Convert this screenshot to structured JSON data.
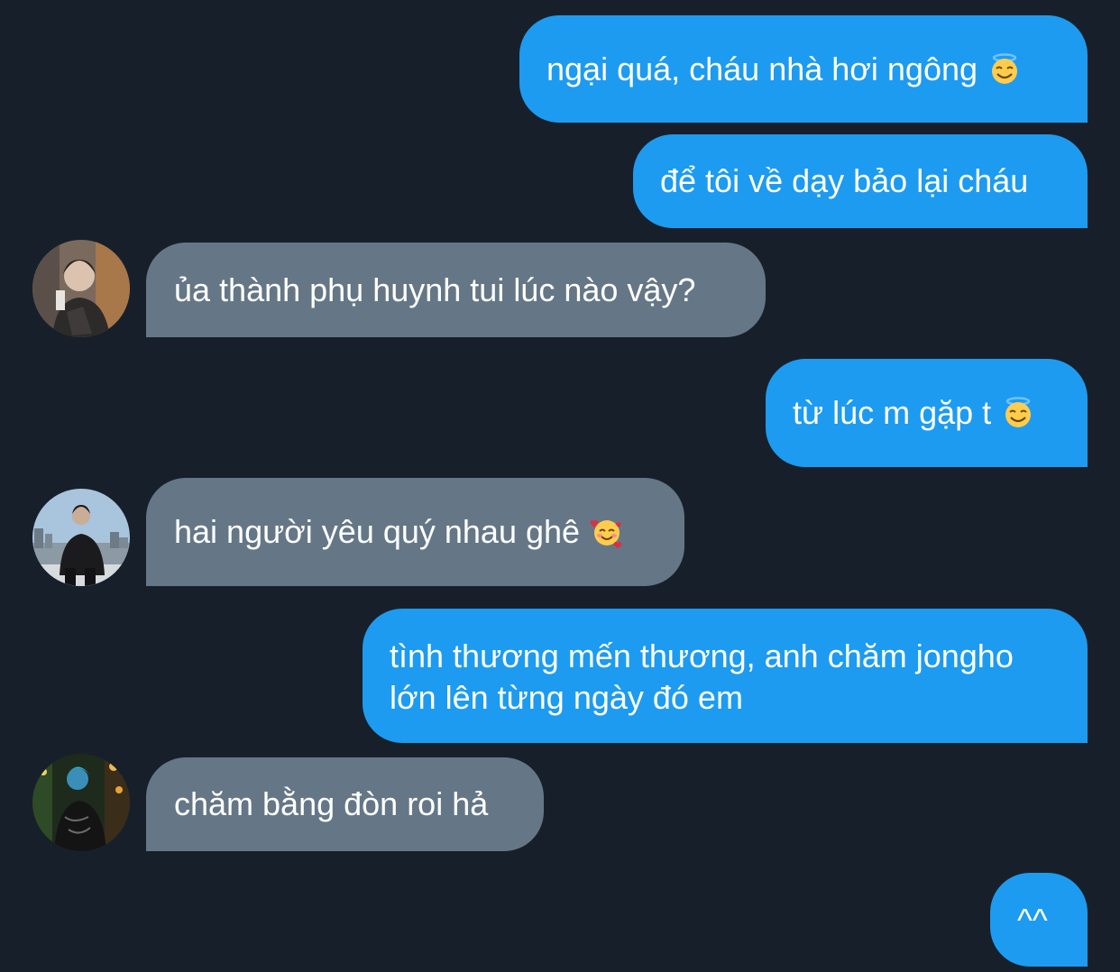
{
  "conversation": {
    "messages": [
      {
        "sender": "me",
        "text": "ngại quá, cháu nhà hơi ngông",
        "emoji": "smiling-face-with-halo"
      },
      {
        "sender": "me",
        "text": "để tôi về dạy bảo lại cháu"
      },
      {
        "sender": "other",
        "text": "ủa thành phụ huynh tui lúc nào vậy?"
      },
      {
        "sender": "me",
        "text": "từ lúc m gặp t",
        "emoji": "smiling-face-with-halo"
      },
      {
        "sender": "other",
        "text": "hai người yêu quý nhau ghê",
        "emoji": "smiling-face-with-hearts"
      },
      {
        "sender": "me",
        "lines": [
          "tình thương mến thương, anh chăm jongho",
          "lớn lên từng ngày đó em"
        ]
      },
      {
        "sender": "other",
        "text": "chăm bằng đòn roi hả"
      },
      {
        "sender": "me",
        "text": "^^"
      }
    ]
  },
  "colors": {
    "background": "#17202a",
    "sent_bubble": "#1d9bf0",
    "received_bubble": "#657786",
    "text": "#ffffff"
  }
}
